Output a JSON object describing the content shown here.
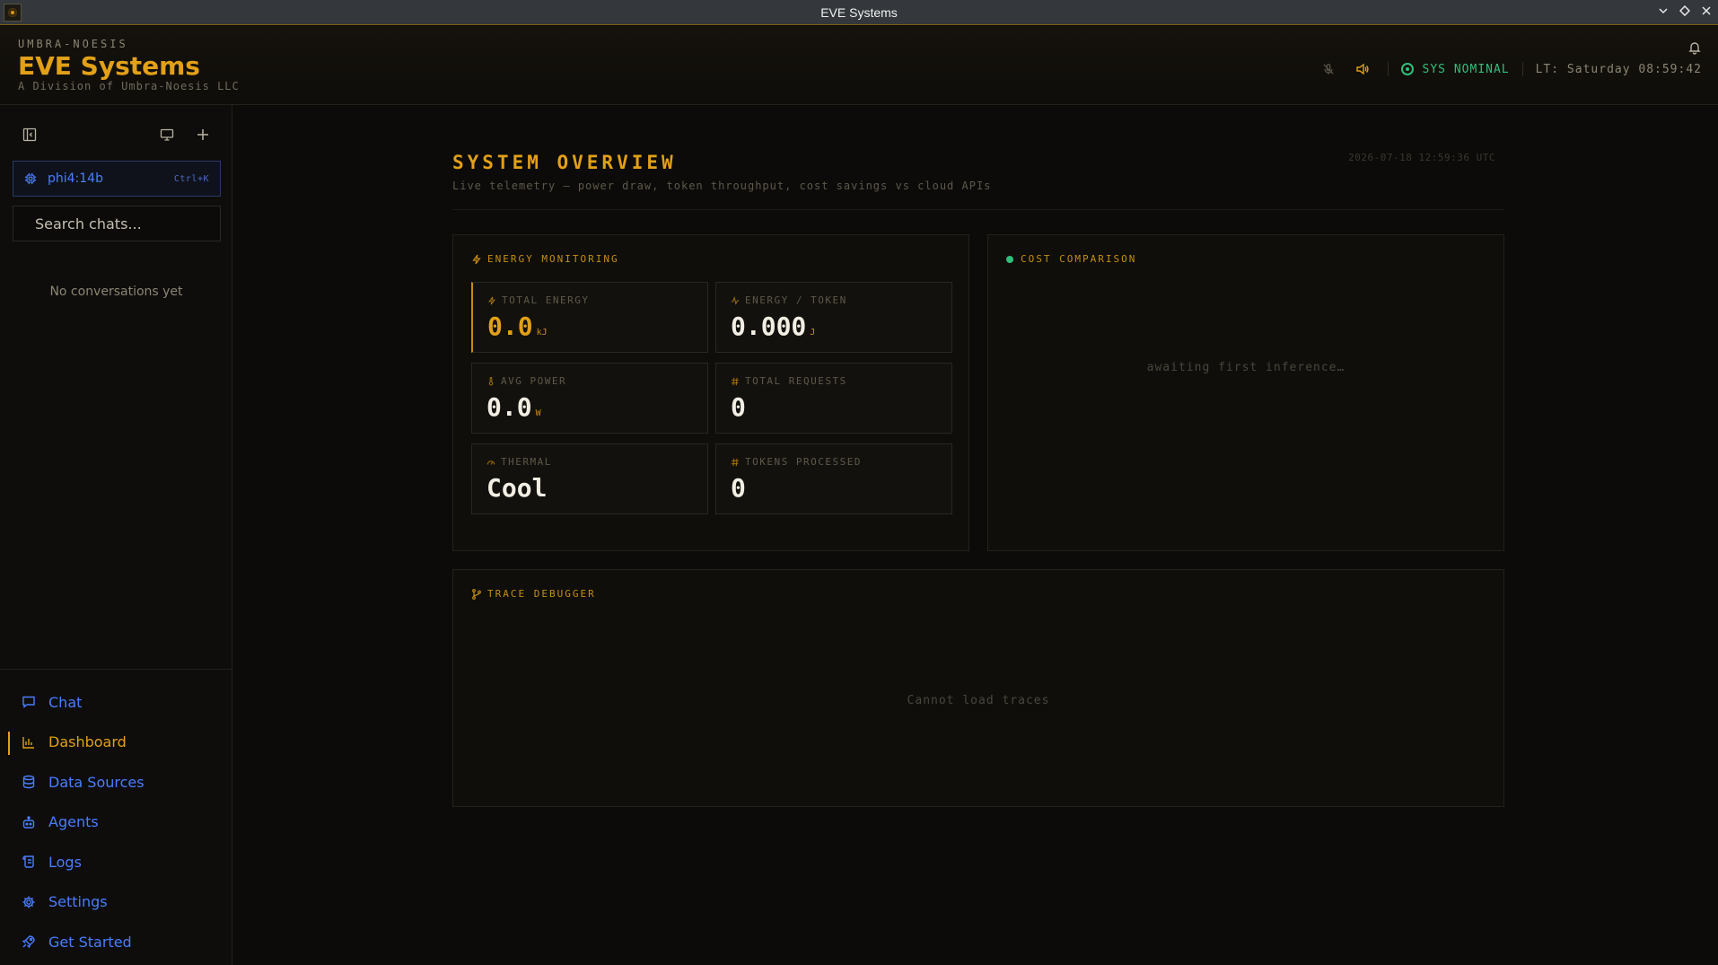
{
  "window": {
    "title": "EVE Systems"
  },
  "brand": {
    "kicker": "UMBRA-NOESIS",
    "title": "EVE Systems",
    "subtitle": "A Division of Umbra-Noesis LLC"
  },
  "header": {
    "status": "SYS NOMINAL",
    "local_time": "LT: Saturday 08:59:42"
  },
  "sidebar": {
    "model": {
      "name": "phi4:14b",
      "shortcut": "Ctrl+K"
    },
    "search_placeholder": "Search chats...",
    "empty_text": "No conversations yet",
    "nav": [
      {
        "label": "Chat",
        "icon": "chat-icon"
      },
      {
        "label": "Dashboard",
        "icon": "bar-chart-icon",
        "active": true
      },
      {
        "label": "Data Sources",
        "icon": "database-icon"
      },
      {
        "label": "Agents",
        "icon": "robot-icon"
      },
      {
        "label": "Logs",
        "icon": "scroll-icon"
      },
      {
        "label": "Settings",
        "icon": "gear-icon"
      },
      {
        "label": "Get Started",
        "icon": "rocket-icon"
      }
    ]
  },
  "overview": {
    "title": "SYSTEM OVERVIEW",
    "subtitle": "Live telemetry — power draw, token throughput, cost savings vs cloud APIs",
    "timestamp": "2026-07-18 12:59:36 UTC"
  },
  "energy": {
    "title": "ENERGY MONITORING",
    "metrics": [
      {
        "label": "TOTAL ENERGY",
        "value": "0.0",
        "unit": "kJ"
      },
      {
        "label": "ENERGY / TOKEN",
        "value": "0.000",
        "unit": "J"
      },
      {
        "label": "AVG POWER",
        "value": "0.0",
        "unit": "W"
      },
      {
        "label": "TOTAL REQUESTS",
        "value": "0",
        "unit": ""
      },
      {
        "label": "THERMAL",
        "value": "Cool",
        "unit": ""
      },
      {
        "label": "TOKENS PROCESSED",
        "value": "0",
        "unit": ""
      }
    ]
  },
  "cost": {
    "title": "COST COMPARISON",
    "placeholder": "awaiting first inference…"
  },
  "trace": {
    "title": "TRACE DEBUGGER",
    "placeholder": "Cannot load traces"
  },
  "colors": {
    "accent": "#e2a018",
    "link": "#4a7dff",
    "ok": "#2fbf7a"
  }
}
